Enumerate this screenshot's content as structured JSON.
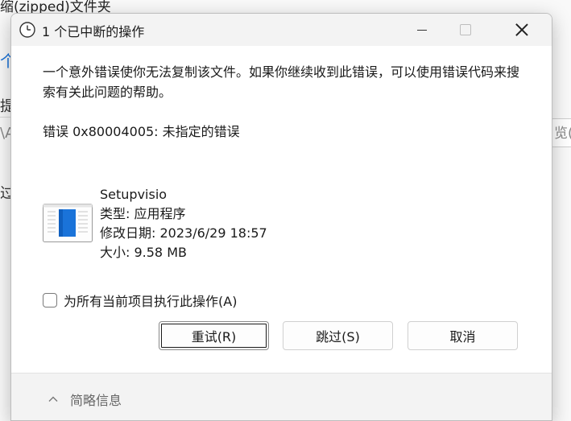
{
  "background": {
    "title_fragment": "缩(zipped)文件夹",
    "fragments": [
      "个",
      "提",
      "\\A",
      "过",
      "览(P"
    ]
  },
  "dialog": {
    "title": "1 个已中断的操作",
    "message": "一个意外错误使你无法复制该文件。如果你继续收到此错误，可以使用错误代码来搜索有关此问题的帮助。",
    "error": "错误 0x80004005: 未指定的错误",
    "file": {
      "name": "Setupvisio",
      "type": "类型: 应用程序",
      "modified": "修改日期: 2023/6/29 18:57",
      "size": "大小: 9.58 MB"
    },
    "checkbox_label": "为所有当前项目执行此操作(A)",
    "checkbox_checked": false,
    "buttons": {
      "retry": "重试(R)",
      "skip": "跳过(S)",
      "cancel": "取消"
    },
    "footer_label": "简略信息"
  },
  "icons": {
    "title": "clock-icon",
    "file": "application-file-icon",
    "footer": "chevron-up-icon"
  },
  "colors": {
    "accent_blue": "#1a73d9",
    "dialog_bg": "#ffffff",
    "chrome_bg": "#f3f3f3"
  }
}
